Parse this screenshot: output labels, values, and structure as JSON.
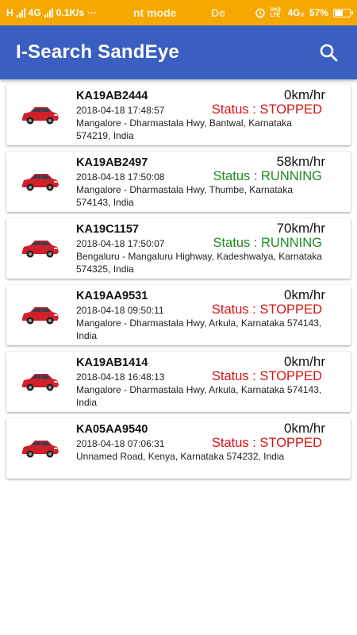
{
  "status_bar": {
    "left_text": "H",
    "network": "4G",
    "speed": "0.1K/s",
    "dots": "···",
    "notification_text": "nt mode",
    "notification_text_2": "De",
    "lte_label": "Vo)) LTE",
    "network_2": "4G₂",
    "battery_percent": "57%",
    "battery_level": 0.57
  },
  "app_bar": {
    "title": "I-Search SandEye",
    "search_icon": "search-icon"
  },
  "colors": {
    "app_bar": "#3b5fc0",
    "status_bar": "#f5a800",
    "stopped": "#d21414",
    "running": "#1f8a1f"
  },
  "vehicles": [
    {
      "plate": "KA19AB2444",
      "speed": "0km/hr",
      "timestamp": "2018-04-18 17:48:57",
      "status": "Status : STOPPED",
      "state": "stopped",
      "address": "Mangalore - Dharmastala Hwy, Bantwal, Karnataka 574219, India",
      "icon": "car-icon"
    },
    {
      "plate": "KA19AB2497",
      "speed": "58km/hr",
      "timestamp": "2018-04-18 17:50:08",
      "status": "Status : RUNNING",
      "state": "running",
      "address": "Mangalore - Dharmastala Hwy, Thumbe, Karnataka 574143, India",
      "icon": "car-icon"
    },
    {
      "plate": "KA19C1157",
      "speed": "70km/hr",
      "timestamp": "2018-04-18 17:50:07",
      "status": "Status : RUNNING",
      "state": "running",
      "address": "Bengaluru - Mangaluru Highway, Kadeshwalya, Karnataka 574325, India",
      "icon": "car-icon"
    },
    {
      "plate": "KA19AA9531",
      "speed": "0km/hr",
      "timestamp": "2018-04-18 09:50:11",
      "status": "Status : STOPPED",
      "state": "stopped",
      "address": "Mangalore - Dharmastala Hwy, Arkula, Karnataka 574143, India",
      "icon": "car-icon"
    },
    {
      "plate": "KA19AB1414",
      "speed": "0km/hr",
      "timestamp": "2018-04-18 16:48:13",
      "status": "Status : STOPPED",
      "state": "stopped",
      "address": "Mangalore - Dharmastala Hwy, Arkula, Karnataka 574143, India",
      "icon": "car-icon"
    },
    {
      "plate": "KA05AA9540",
      "speed": "0km/hr",
      "timestamp": "2018-04-18 07:06:31",
      "status": "Status : STOPPED",
      "state": "stopped",
      "address": "Unnamed Road, Kenya, Karnataka 574232, India",
      "icon": "car-icon"
    }
  ]
}
